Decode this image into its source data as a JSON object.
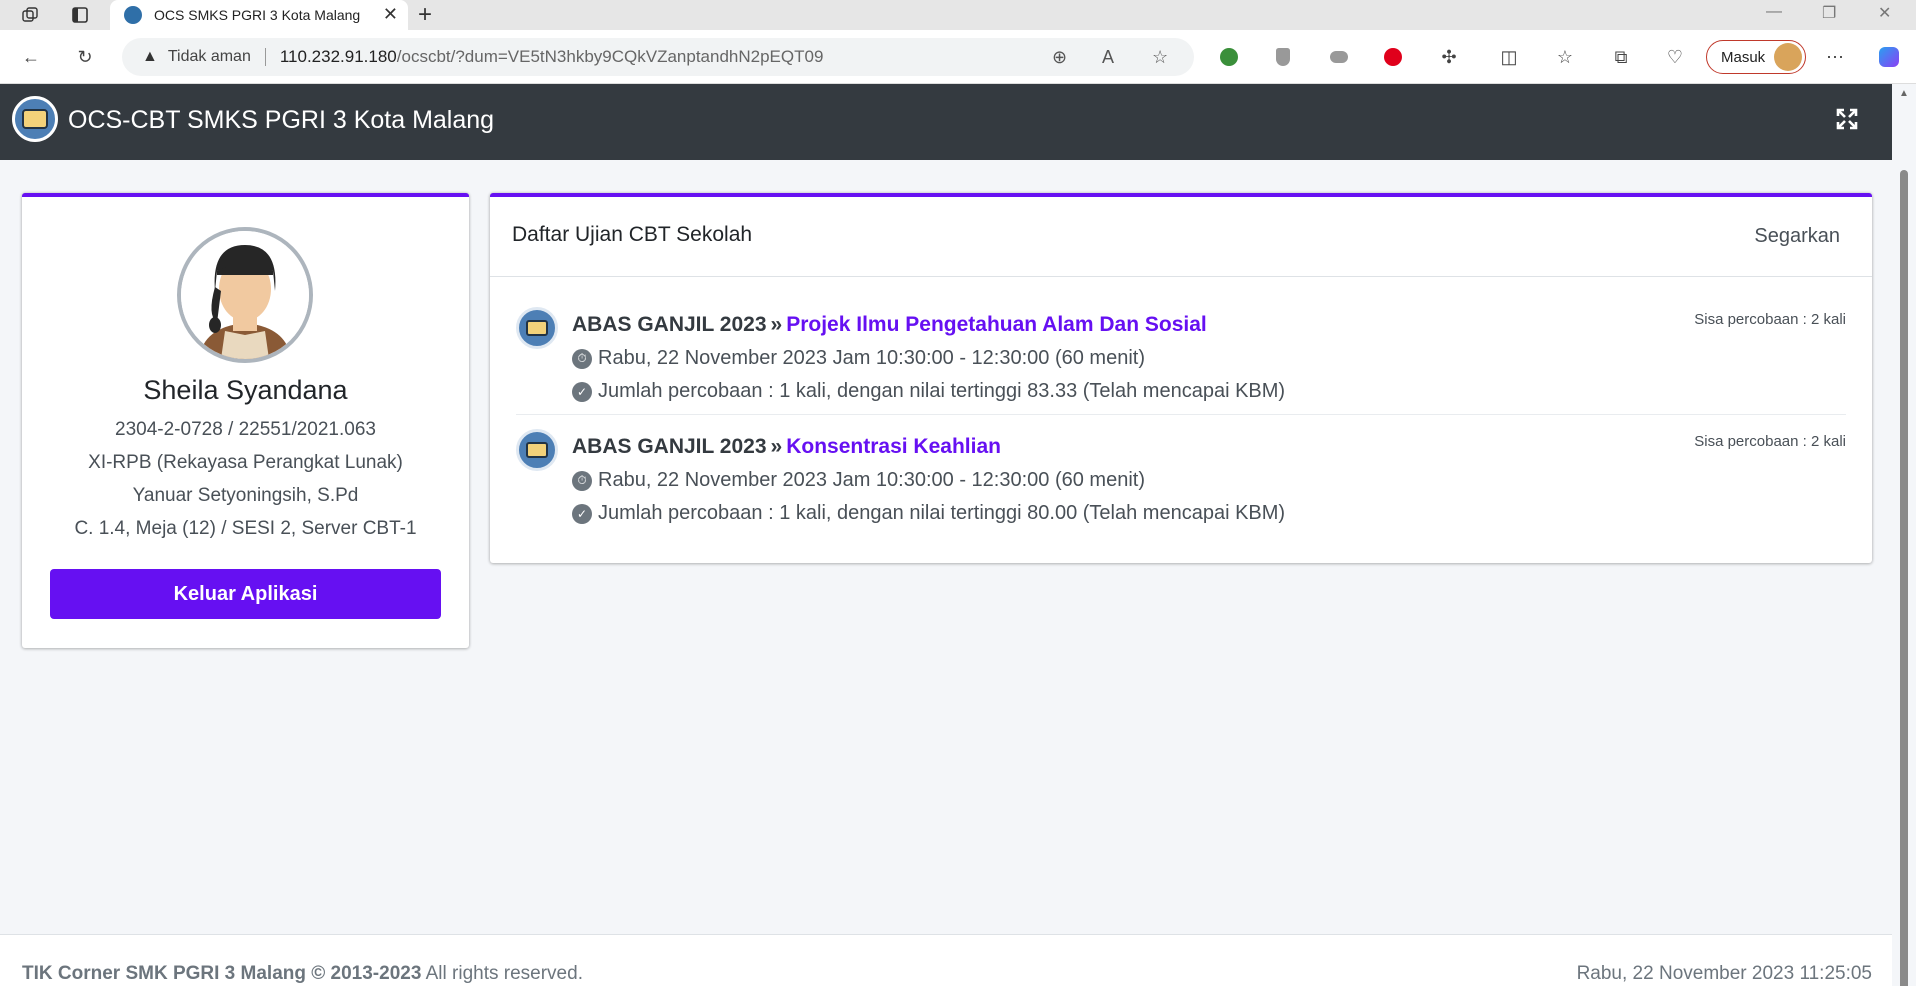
{
  "browser": {
    "tab_title": "OCS SMKS PGRI 3 Kota Malang",
    "security_label": "Tidak aman",
    "url_host": "110.232.91.180",
    "url_path": "/ocscbt/?dum=VE5tN3hkby9CQkVZanptandhN2pEQT09",
    "profile_button": "Masuk"
  },
  "app": {
    "title": "OCS-CBT SMKS PGRI 3 Kota Malang"
  },
  "profile": {
    "name": "Sheila Syandana",
    "id_line": "2304-2-0728 / 22551/2021.063",
    "class_line": "XI-RPB (Rekayasa Perangkat Lunak)",
    "teacher_line": "Yanuar Setyoningsih, S.Pd",
    "room_line": "C. 1.4, Meja (12) / SESI 2, Server CBT-1",
    "logout_label": "Keluar Aplikasi"
  },
  "exams": {
    "title": "Daftar Ujian CBT Sekolah",
    "refresh_label": "Segarkan",
    "items": [
      {
        "period": "ABAS GANJIL 2023",
        "subject": "Projek Ilmu Pengetahuan Alam Dan Sosial",
        "schedule": "Rabu, 22 November 2023 Jam 10:30:00 - 12:30:00 (60 menit)",
        "attempts": "Jumlah percobaan : 1 kali, dengan nilai tertinggi 83.33 (Telah mencapai KBM)",
        "remaining": "Sisa percobaan : 2 kali"
      },
      {
        "period": "ABAS GANJIL 2023",
        "subject": "Konsentrasi Keahlian",
        "schedule": "Rabu, 22 November 2023 Jam 10:30:00 - 12:30:00 (60 menit)",
        "attempts": "Jumlah percobaan : 1 kali, dengan nilai tertinggi 80.00 (Telah mencapai KBM)",
        "remaining": "Sisa percobaan : 2 kali"
      }
    ]
  },
  "footer": {
    "brand": "TIK Corner SMK PGRI 3 Malang © 2013-2023",
    "rights": " All rights reserved.",
    "datetime": "Rabu, 22 November 2023 11:25:05"
  },
  "colors": {
    "accent": "#6610f2",
    "header_bg": "#343a40"
  },
  "icons": {
    "fullscreen": "expand-icon",
    "schedule": "stopwatch-icon",
    "attempts": "check-circle-icon"
  }
}
